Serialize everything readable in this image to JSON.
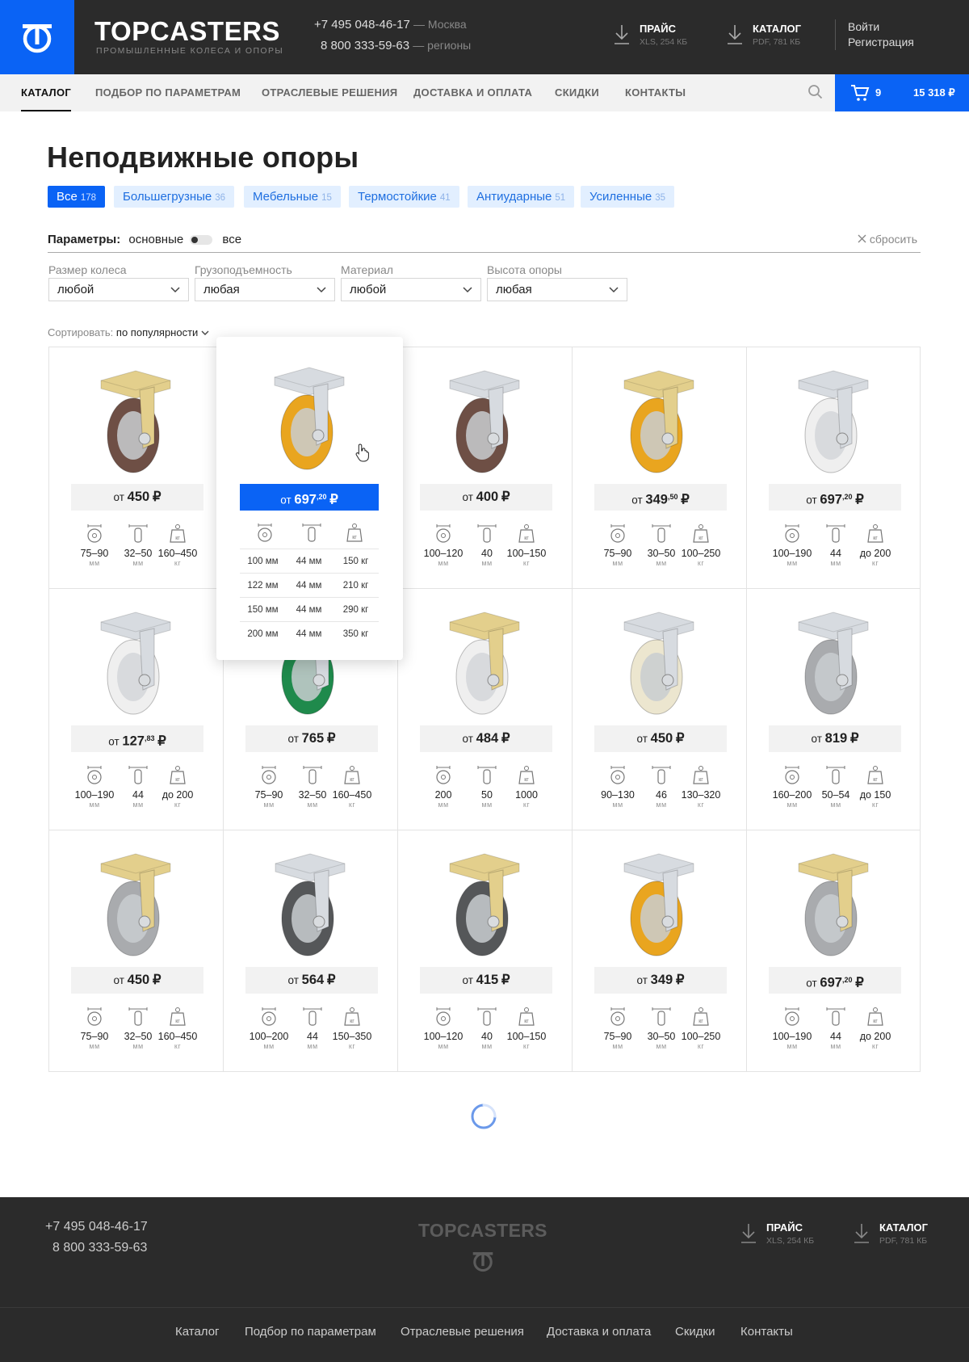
{
  "header": {
    "brand": "TOPCASTERS",
    "tagline": "ПРОМЫШЛЕННЫЕ КОЛЕСА И ОПОРЫ",
    "phones": [
      {
        "number": "+7 495 048-46-17",
        "region": "— Москва"
      },
      {
        "number": "8 800 333-59-63",
        "region": "— регионы"
      }
    ],
    "downloads": [
      {
        "title": "ПРАЙС",
        "sub": "XLS, 254 КБ"
      },
      {
        "title": "КАТАЛОГ",
        "sub": "PDF, 781 КБ"
      }
    ],
    "login": "Войти",
    "register": "Регистрация"
  },
  "nav": {
    "items": [
      "КАТАЛОГ",
      "ПОДБОР ПО ПАРАМЕТРАМ",
      "ОТРАСЛЕВЫЕ РЕШЕНИЯ",
      "ДОСТАВКА И ОПЛАТА",
      "СКИДКИ",
      "КОНТАКТЫ"
    ],
    "cart_count": "9",
    "cart_sum": "15 318 ₽"
  },
  "page": {
    "title": "Неподвижные опоры",
    "chips": [
      {
        "label": "Все",
        "count": "178"
      },
      {
        "label": "Большегрузные",
        "count": "36"
      },
      {
        "label": "Мебельные",
        "count": "15"
      },
      {
        "label": "Термостойкие",
        "count": "41"
      },
      {
        "label": "Антиударные",
        "count": "51"
      },
      {
        "label": "Усиленные",
        "count": "35"
      }
    ],
    "params_label": "Параметры:",
    "params_basic": "основные",
    "params_all": "все",
    "reset": "сбросить",
    "filters": [
      {
        "label": "Размер колеса",
        "value": "любой"
      },
      {
        "label": "Грузоподъемность",
        "value": "любая"
      },
      {
        "label": "Материал",
        "value": "любой"
      },
      {
        "label": "Высота опоры",
        "value": "любая"
      }
    ],
    "sort_label": "Сортировать:",
    "sort_value": "по популярности"
  },
  "products": [
    {
      "price_prefix": "от",
      "price": "450",
      "cents": "",
      "currency": "₽",
      "size": "75–90",
      "width": "32–50",
      "load": "160–450",
      "plate": "#e3cf8c",
      "wheel": "#6e4f45",
      "hub": "#c9ccd0"
    },
    {
      "price_prefix": "от",
      "price": "697",
      "cents": ",20",
      "currency": "₽",
      "size": "100 мм",
      "width": "44 мм",
      "load": "150 кг",
      "plate": "#d7dbe0",
      "wheel": "#e9a51f",
      "hub": "#c9ccd0"
    },
    {
      "price_prefix": "от",
      "price": "400",
      "cents": "",
      "currency": "₽",
      "size": "100–120",
      "width": "40",
      "load": "100–150",
      "plate": "#d7dbe0",
      "wheel": "#6e4f45",
      "hub": "#c9ccd0"
    },
    {
      "price_prefix": "от",
      "price": "349",
      "cents": ",50",
      "currency": "₽",
      "size": "75–90",
      "width": "30–50",
      "load": "100–250",
      "plate": "#e3cf8c",
      "wheel": "#e9a51f",
      "hub": "#c9ccd0"
    },
    {
      "price_prefix": "от",
      "price": "697",
      "cents": ",20",
      "currency": "₽",
      "size": "100–190",
      "width": "44",
      "load": "до 200",
      "plate": "#d7dbe0",
      "wheel": "#efefef",
      "hub": "#d4d6d9"
    },
    {
      "price_prefix": "от",
      "price": "127",
      "cents": ",83",
      "currency": "₽",
      "size": "100–190",
      "width": "44",
      "load": "до 200",
      "plate": "#d7dbe0",
      "wheel": "#efefef",
      "hub": "#d4d6d9"
    },
    {
      "price_prefix": "от",
      "price": "765",
      "cents": "",
      "currency": "₽",
      "size": "75–90",
      "width": "32–50",
      "load": "160–450",
      "plate": "#d7dbe0",
      "wheel": "#1f8a4c",
      "hub": "#c9ccd0"
    },
    {
      "price_prefix": "от",
      "price": "484",
      "cents": "",
      "currency": "₽",
      "size": "200",
      "width": "50",
      "load": "1000",
      "plate": "#e3cf8c",
      "wheel": "#efefef",
      "hub": "#d4d6d9"
    },
    {
      "price_prefix": "от",
      "price": "450",
      "cents": "",
      "currency": "₽",
      "size": "90–130",
      "width": "46",
      "load": "130–320",
      "plate": "#d7dbe0",
      "wheel": "#ece6cf",
      "hub": "#c9ccd0"
    },
    {
      "price_prefix": "от",
      "price": "819",
      "cents": "",
      "currency": "₽",
      "size": "160–200",
      "width": "50–54",
      "load": "до 150",
      "plate": "#d7dbe0",
      "wheel": "#a9abae",
      "hub": "#c9ccd0"
    },
    {
      "price_prefix": "от",
      "price": "450",
      "cents": "",
      "currency": "₽",
      "size": "75–90",
      "width": "32–50",
      "load": "160–450",
      "plate": "#e3cf8c",
      "wheel": "#a9abae",
      "hub": "#c9ccd0"
    },
    {
      "price_prefix": "от",
      "price": "564",
      "cents": "",
      "currency": "₽",
      "size": "100–200",
      "width": "44",
      "load": "150–350",
      "plate": "#d7dbe0",
      "wheel": "#555759",
      "hub": "#c9ccd0"
    },
    {
      "price_prefix": "от",
      "price": "415",
      "cents": "",
      "currency": "₽",
      "size": "100–120",
      "width": "40",
      "load": "100–150",
      "plate": "#e3cf8c",
      "wheel": "#555759",
      "hub": "#c9ccd0"
    },
    {
      "price_prefix": "от",
      "price": "349",
      "cents": "",
      "currency": "₽",
      "size": "75–90",
      "width": "30–50",
      "load": "100–250",
      "plate": "#d7dbe0",
      "wheel": "#e9a51f",
      "hub": "#c9ccd0"
    },
    {
      "price_prefix": "от",
      "price": "697",
      "cents": ",20",
      "currency": "₽",
      "size": "100–190",
      "width": "44",
      "load": "до 200",
      "plate": "#e3cf8c",
      "wheel": "#a9abae",
      "hub": "#c9ccd0"
    }
  ],
  "units": {
    "mm": "мм",
    "kg": "кг"
  },
  "popup": {
    "rows": [
      [
        "100 мм",
        "44 мм",
        "150 кг"
      ],
      [
        "122 мм",
        "44 мм",
        "210 кг"
      ],
      [
        "150 мм",
        "44 мм",
        "290 кг"
      ],
      [
        "200 мм",
        "44 мм",
        "350 кг"
      ]
    ]
  },
  "footer": {
    "phones": [
      "+7 495 048-46-17",
      "8 800 333-59-63"
    ],
    "brand": "TOPCASTERS",
    "downloads": [
      {
        "title": "ПРАЙС",
        "sub": "XLS, 254 КБ"
      },
      {
        "title": "КАТАЛОГ",
        "sub": "PDF, 781 КБ"
      }
    ],
    "links": [
      "Каталог",
      "Подбор по параметрам",
      "Отраслевые решения",
      "Доставка и оплата",
      "Скидки",
      "Контакты"
    ]
  },
  "colors": {
    "accent": "#0a63f5",
    "header_bg": "#2b2b2b",
    "chip_bg": "#e2efff"
  }
}
